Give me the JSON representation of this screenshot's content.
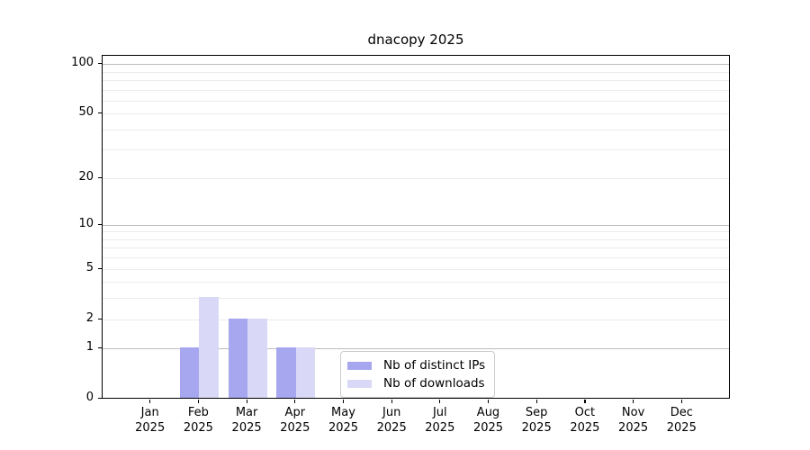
{
  "title": "dnacopy 2025",
  "chart_data": {
    "type": "bar",
    "title": "dnacopy 2025",
    "categories": [
      {
        "month": "Jan",
        "year": "2025"
      },
      {
        "month": "Feb",
        "year": "2025"
      },
      {
        "month": "Mar",
        "year": "2025"
      },
      {
        "month": "Apr",
        "year": "2025"
      },
      {
        "month": "May",
        "year": "2025"
      },
      {
        "month": "Jun",
        "year": "2025"
      },
      {
        "month": "Jul",
        "year": "2025"
      },
      {
        "month": "Aug",
        "year": "2025"
      },
      {
        "month": "Sep",
        "year": "2025"
      },
      {
        "month": "Oct",
        "year": "2025"
      },
      {
        "month": "Nov",
        "year": "2025"
      },
      {
        "month": "Dec",
        "year": "2025"
      }
    ],
    "series": [
      {
        "name": "Nb of distinct IPs",
        "color": "#a7a7f0",
        "values": [
          0,
          1,
          2,
          1,
          0,
          0,
          0,
          0,
          0,
          0,
          0,
          0
        ]
      },
      {
        "name": "Nb of downloads",
        "color": "#d9d9f7",
        "values": [
          0,
          3,
          2,
          1,
          0,
          0,
          0,
          0,
          0,
          0,
          0,
          0
        ]
      }
    ],
    "y_axis": {
      "ticks": [
        0,
        1,
        2,
        5,
        10,
        20,
        50,
        100
      ],
      "major_gridlines": [
        1,
        10,
        100
      ],
      "minor_gridlines": [
        3,
        4,
        6,
        7,
        8,
        9,
        30,
        40,
        60,
        70,
        80,
        90
      ],
      "scale": "log1p",
      "ylim": [
        0,
        112
      ]
    },
    "xlabel": "",
    "ylabel": "",
    "grid": "horizontal",
    "legend_position": "lower center",
    "colors": {
      "major_grid": "#bdbdbd",
      "minor_grid": "#ebebeb",
      "axis": "#000000",
      "background": "#ffffff"
    }
  }
}
